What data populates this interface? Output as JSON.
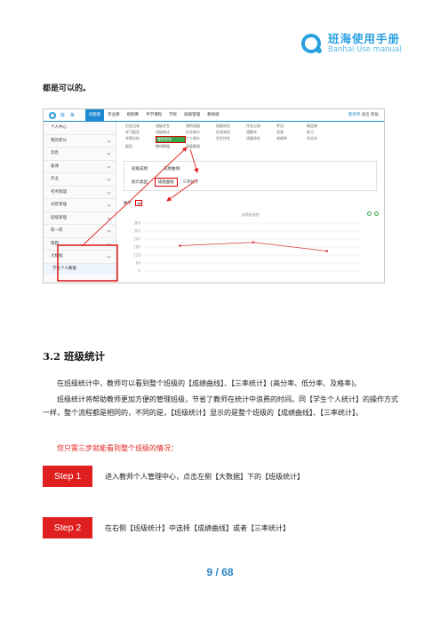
{
  "header": {
    "logo_title": "班海使用手册",
    "logo_subtitle": "Banhai Use manual"
  },
  "intro_text": "都是可以的。",
  "screenshot": {
    "brand": "班 海",
    "nav": [
      "试题库",
      "作业库",
      "视频库",
      "手学课程",
      "学校",
      "班级管理",
      "教研组"
    ],
    "user": "我老师",
    "user_actions": [
      "退出",
      "帮助"
    ],
    "sidebar": [
      "个人中心",
      "我的积分",
      "消息",
      "备课",
      "作业",
      "考务管理",
      "试卷管理",
      "班级管理",
      "练一练",
      "错题",
      "大数据"
    ],
    "sidebar_sub": "学生个人数据",
    "grid_words": [
      "历史记录",
      "班级学生",
      "我的班级",
      "班级成员",
      "作业记录",
      "考试",
      "精品课",
      "学习报告",
      "班级统计",
      "作业统计",
      "在线测试",
      "错题本",
      "资源",
      "练习",
      "学情分析",
      "课堂表现",
      "个人统计",
      "学生排名",
      "班级排名",
      "成绩单",
      "作业本",
      "报告",
      "教研数据",
      "班级数据",
      "",
      "",
      "",
      ""
    ],
    "highlight_index": 15,
    "stats": {
      "row1_a": "班级成绩",
      "row1_b": "成绩曲线:",
      "row2_label": "统计类型:",
      "row2_tag": "成绩曲线",
      "row2_alt": "三率统计"
    },
    "subject_label": "数学",
    "chart_title": "成绩曲线图"
  },
  "chart_data": {
    "type": "line",
    "categories": [
      "",
      "",
      ""
    ],
    "series": [
      {
        "values": [
          190,
          215,
          150
        ]
      }
    ],
    "y_ticks": [
      "360",
      "300",
      "240",
      "180",
      "120",
      "60",
      "0"
    ],
    "ylim": [
      0,
      360
    ],
    "color": "#d63b3b"
  },
  "section": {
    "title": "3.2 班级统计",
    "para1": "在班级统计中，教师可以看到整个班级的【成绩曲线】、【三率统计】(高分率、低分率、及格率)。",
    "para2": "班级统计将帮助教师更加方便的管理班级，节省了教师在统计中浪费的时间。同【学生个人统计】的操作方式一样，整个流程都是相同的，不同的是，【班级统计】显示的是整个班级的【成绩曲线】、【三率统计】。",
    "para3": "您只需三步就能看到整个班级的情况："
  },
  "steps": [
    {
      "label": "Step 1",
      "text": "进入教师个人管理中心，点击左侧【大数据】下的【班级统计】"
    },
    {
      "label": "Step 2",
      "text": "在右侧【班级统计】中选择【成绩曲线】或者【三率统计】"
    }
  ],
  "page": {
    "current": "9",
    "total": "68",
    "sep": " / "
  },
  "colors": {
    "accent": "#2aa0e0",
    "red": "#e02020"
  }
}
